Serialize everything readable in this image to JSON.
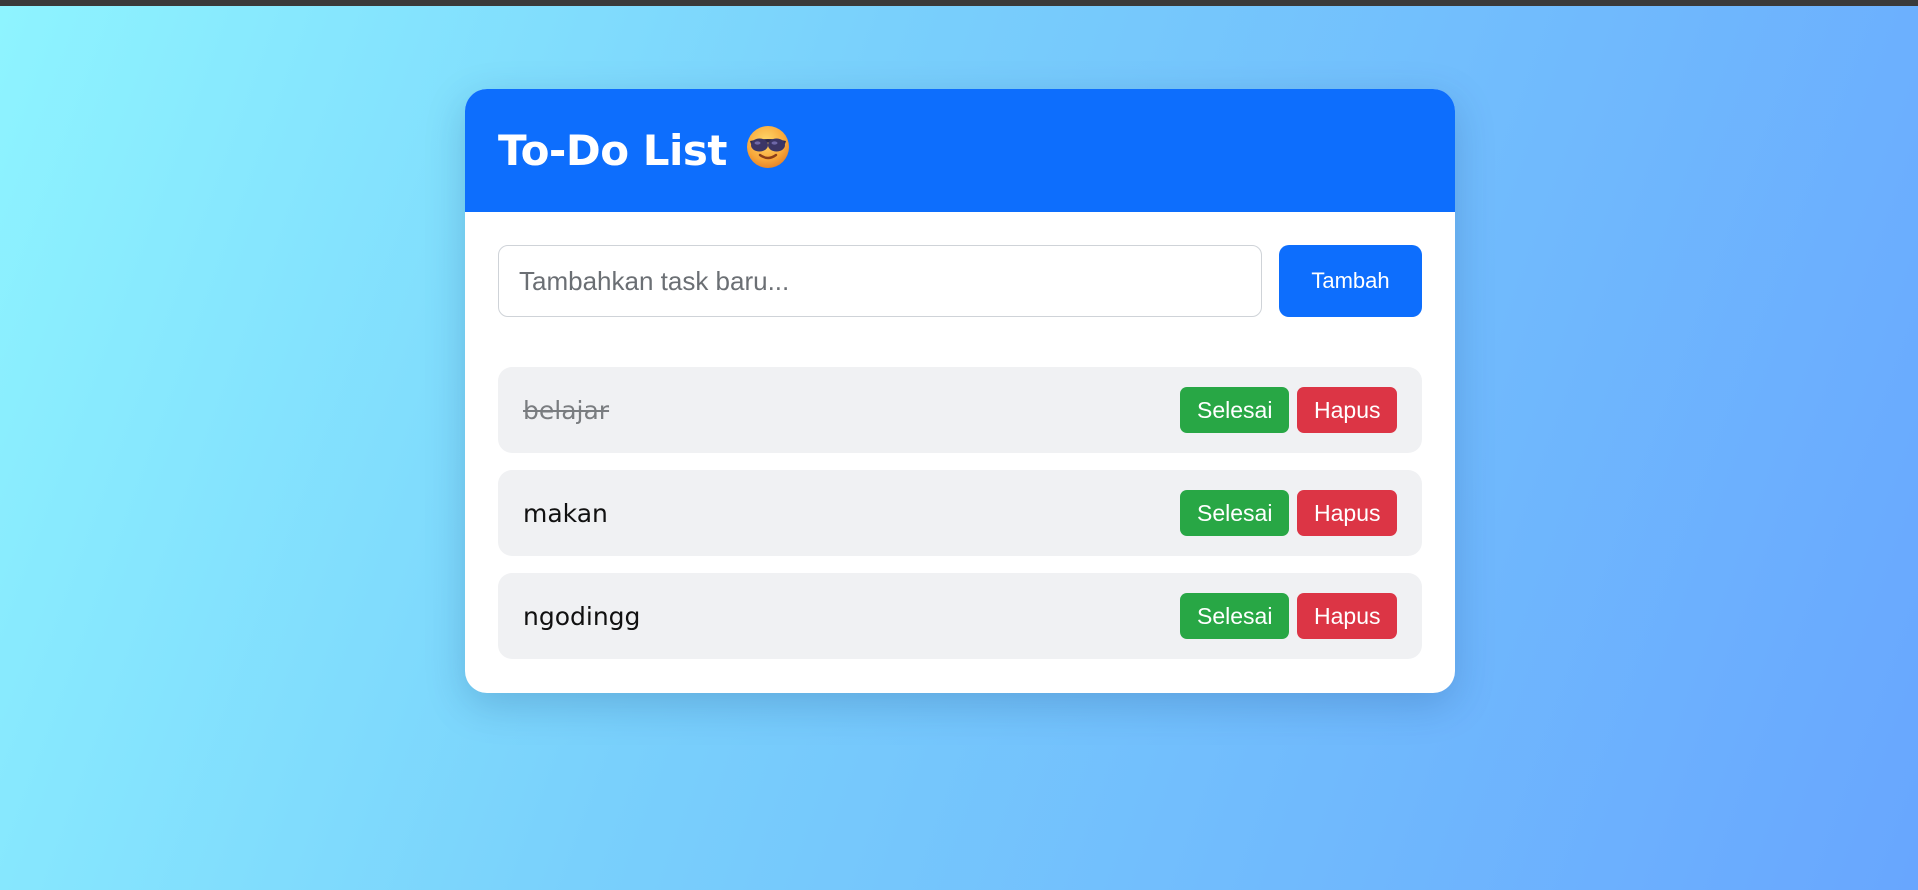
{
  "header": {
    "title": "To-Do List",
    "emoji_icon": "smiling-face-with-sunglasses-icon"
  },
  "form": {
    "placeholder": "Tambahkan task baru...",
    "value": "",
    "add_label": "Tambah"
  },
  "tasks": [
    {
      "text": "belajar",
      "completed": true,
      "done_label": "Selesai",
      "delete_label": "Hapus"
    },
    {
      "text": "makan",
      "completed": false,
      "done_label": "Selesai",
      "delete_label": "Hapus"
    },
    {
      "text": "ngodingg",
      "completed": false,
      "done_label": "Selesai",
      "delete_label": "Hapus"
    }
  ],
  "colors": {
    "primary": "#0d6efd",
    "success": "#28a745",
    "danger": "#dc3545",
    "item_bg": "#f0f1f3"
  }
}
